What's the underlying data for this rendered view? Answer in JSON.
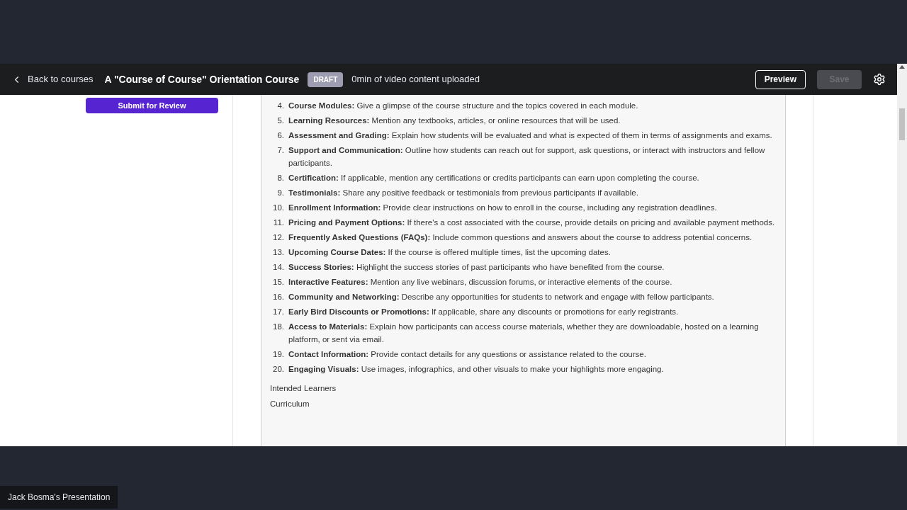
{
  "header": {
    "back_link": "Back to courses",
    "course_title": "A \"Course of Course\" Orientation Course",
    "status_badge": "DRAFT",
    "video_info": "0min of video content uploaded",
    "preview_button": "Preview",
    "save_button": {
      "label": "Save",
      "disabled": true
    }
  },
  "sidebar": {
    "submit_button": "Submit for Review"
  },
  "list": [
    {
      "number": "4.",
      "text": "**Course Modules:** Give a glimpse of the course structure and the topics covered in each module."
    },
    {
      "number": "5.",
      "text": "**Learning Resources:** Mention any textbooks, articles, or online resources that will be used."
    },
    {
      "number": "6.",
      "text": "**Assessment and Grading:** Explain how students will be evaluated and what is expected of them in terms of assignments and exams."
    },
    {
      "number": "7.",
      "text": "**Support and Communication:** Outline how students can reach out for support, ask questions, or interact with instructors and fellow participants."
    },
    {
      "number": "8.",
      "text": "**Certification:** If applicable, mention any certifications or credits participants can earn upon completing the course."
    },
    {
      "number": "9.",
      "text": "**Testimonials:** Share any positive feedback or testimonials from previous participants if available."
    },
    {
      "number": "10.",
      "text": "**Enrollment Information:** Provide clear instructions on how to enroll in the course, including any registration deadlines."
    },
    {
      "number": "11.",
      "text": "**Pricing and Payment Options:** If there's a cost associated with the course, provide details on pricing and available payment methods."
    },
    {
      "number": "12.",
      "text": "**Frequently Asked Questions (FAQs):** Include common questions and answers about the course to address potential concerns."
    },
    {
      "number": "13.",
      "text": "**Upcoming Course Dates:** If the course is offered multiple times, list the upcoming dates."
    },
    {
      "number": "14.",
      "text": "**Success Stories:** Highlight the success stories of past participants who have benefited from the course."
    },
    {
      "number": "15.",
      "text": "**Interactive Features:** Mention any live webinars, discussion forums, or interactive elements of the course."
    },
    {
      "number": "16.",
      "text": "**Community and Networking:** Describe any opportunities for students to network and engage with fellow participants."
    },
    {
      "number": "17.",
      "text": "**Early Bird Discounts or Promotions:** If applicable, share any discounts or promotions for early registrants."
    },
    {
      "number": "18.",
      "text": "**Access to Materials:** Explain how participants can access course materials, whether they are downloadable, hosted on a learning platform, or sent via email."
    },
    {
      "number": "19.",
      "text": "**Contact Information:** Provide contact details for any questions or assistance related to the course."
    },
    {
      "number": "20.",
      "text": "**Engaging Visuals:** Use images, infographics, and other visuals to make your highlights more engaging."
    }
  ],
  "sections": [
    "Intended Learners",
    "Curriculum"
  ],
  "presenter_label": "Jack Bosma's Presentation"
}
